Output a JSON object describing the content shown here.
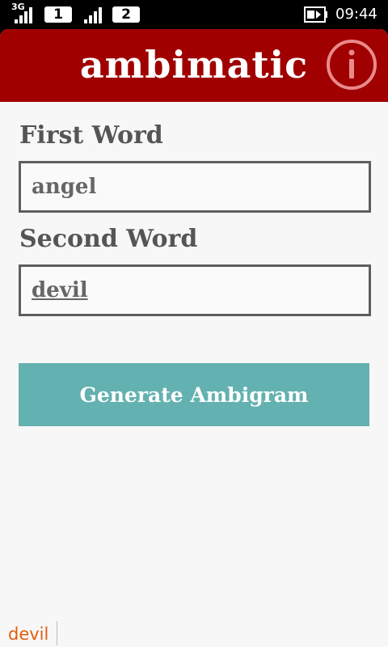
{
  "status_bar": {
    "network_type": "3G",
    "sim1_label": "1",
    "sim2_label": "2",
    "time": "09:44",
    "icons": [
      "signal-bars-icon",
      "signal-bars-icon",
      "battery-charging-icon"
    ]
  },
  "app": {
    "title": "ambimatic",
    "info_icon": "info-icon",
    "header_color": "#a00000",
    "accent_color": "#64b1b1"
  },
  "form": {
    "first_word_label": "First Word",
    "first_word_value": "angel",
    "second_word_label": "Second Word",
    "second_word_value": "devil",
    "generate_label": "Generate Ambigram"
  },
  "tray": {
    "label": "devil"
  }
}
